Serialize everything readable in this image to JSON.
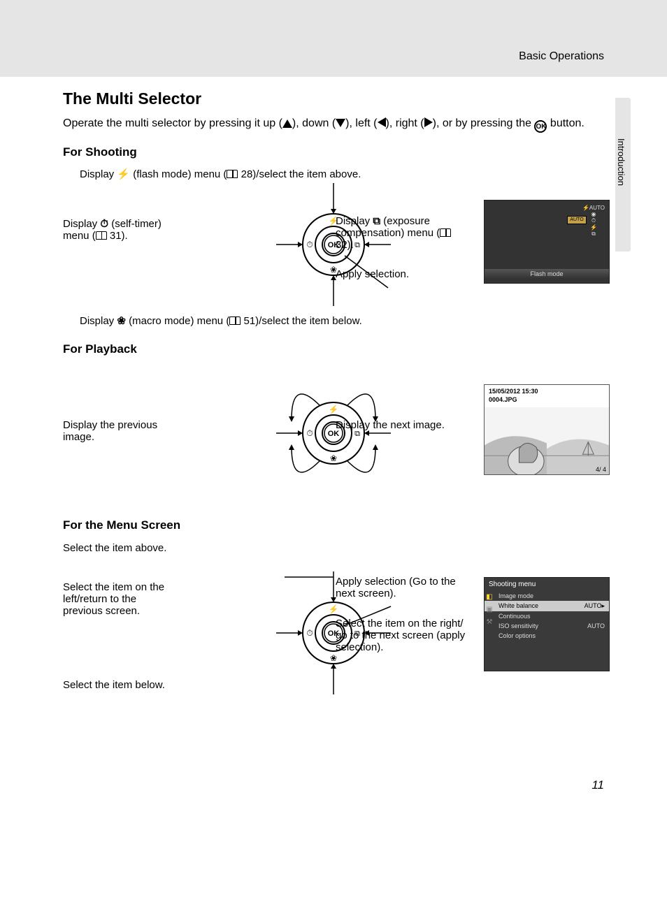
{
  "header": {
    "chapter": "Basic Operations",
    "side_tab": "Introduction"
  },
  "title": "The Multi Selector",
  "intro_parts": {
    "a": "Operate the multi selector by pressing it up (",
    "b": "), down (",
    "c": "), left (",
    "d": "), right (",
    "e": "), or by pressing the ",
    "f": " button."
  },
  "ok_glyph": "OK",
  "shooting": {
    "heading": "For Shooting",
    "top_a": "Display ",
    "top_b": " (flash mode) menu (",
    "top_c": " 28)/select the item above.",
    "left_a": "Display ",
    "left_b": " (self-timer) menu (",
    "left_c": " 31).",
    "right_a": "Display ",
    "right_b": " (exposure compensation) menu (",
    "right_c": " 32).",
    "apply": "Apply selection.",
    "bottom_a": "Display ",
    "bottom_b": " (macro mode) menu (",
    "bottom_c": " 51)/select the item below.",
    "screen": {
      "auto_label": "AUTO",
      "flash_label": "Flash mode"
    }
  },
  "playback": {
    "heading": "For Playback",
    "left": "Display the previous image.",
    "right": "Display the next image.",
    "screen": {
      "timestamp": "15/05/2012  15:30",
      "filename": "0004.JPG",
      "counter": "4/   4"
    }
  },
  "menu": {
    "heading": "For the Menu Screen",
    "up": "Select the item above.",
    "left": "Select the item on the left/return to the previous screen.",
    "down": "Select the item below.",
    "ok": "Apply selection (Go to the next screen).",
    "right": "Select the item on the right/\ngo to the next screen (apply selection).",
    "screen": {
      "title": "Shooting menu",
      "items": [
        {
          "label": "Image mode",
          "val": ""
        },
        {
          "label": "White balance",
          "val": "AUTO▸"
        },
        {
          "label": "Continuous",
          "val": ""
        },
        {
          "label": "ISO sensitivity",
          "val": "AUTO"
        },
        {
          "label": "Color options",
          "val": ""
        }
      ]
    }
  },
  "page_number": "11"
}
